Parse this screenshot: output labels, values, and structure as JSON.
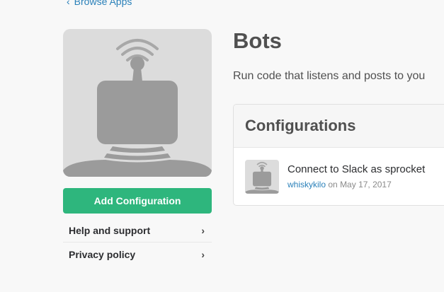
{
  "nav": {
    "back_label": "Browse Apps"
  },
  "app": {
    "title": "Bots",
    "description": "Run code that listens and posts to you",
    "add_button": "Add Configuration"
  },
  "side_links": [
    {
      "label": "Help and support"
    },
    {
      "label": "Privacy policy"
    }
  ],
  "configurations": {
    "heading": "Configurations",
    "items": [
      {
        "name": "Connect to Slack as sprocket",
        "user": "whiskykilo",
        "on_word": "on",
        "date": "May 17, 2017"
      }
    ]
  },
  "colors": {
    "accent_green": "#2eb67d",
    "link_blue": "#2a80b9",
    "icon_gray": "#9b9b9b"
  },
  "icons": [
    "chevron-left-icon",
    "bot-antenna-illustration",
    "chevron-right-icon"
  ]
}
